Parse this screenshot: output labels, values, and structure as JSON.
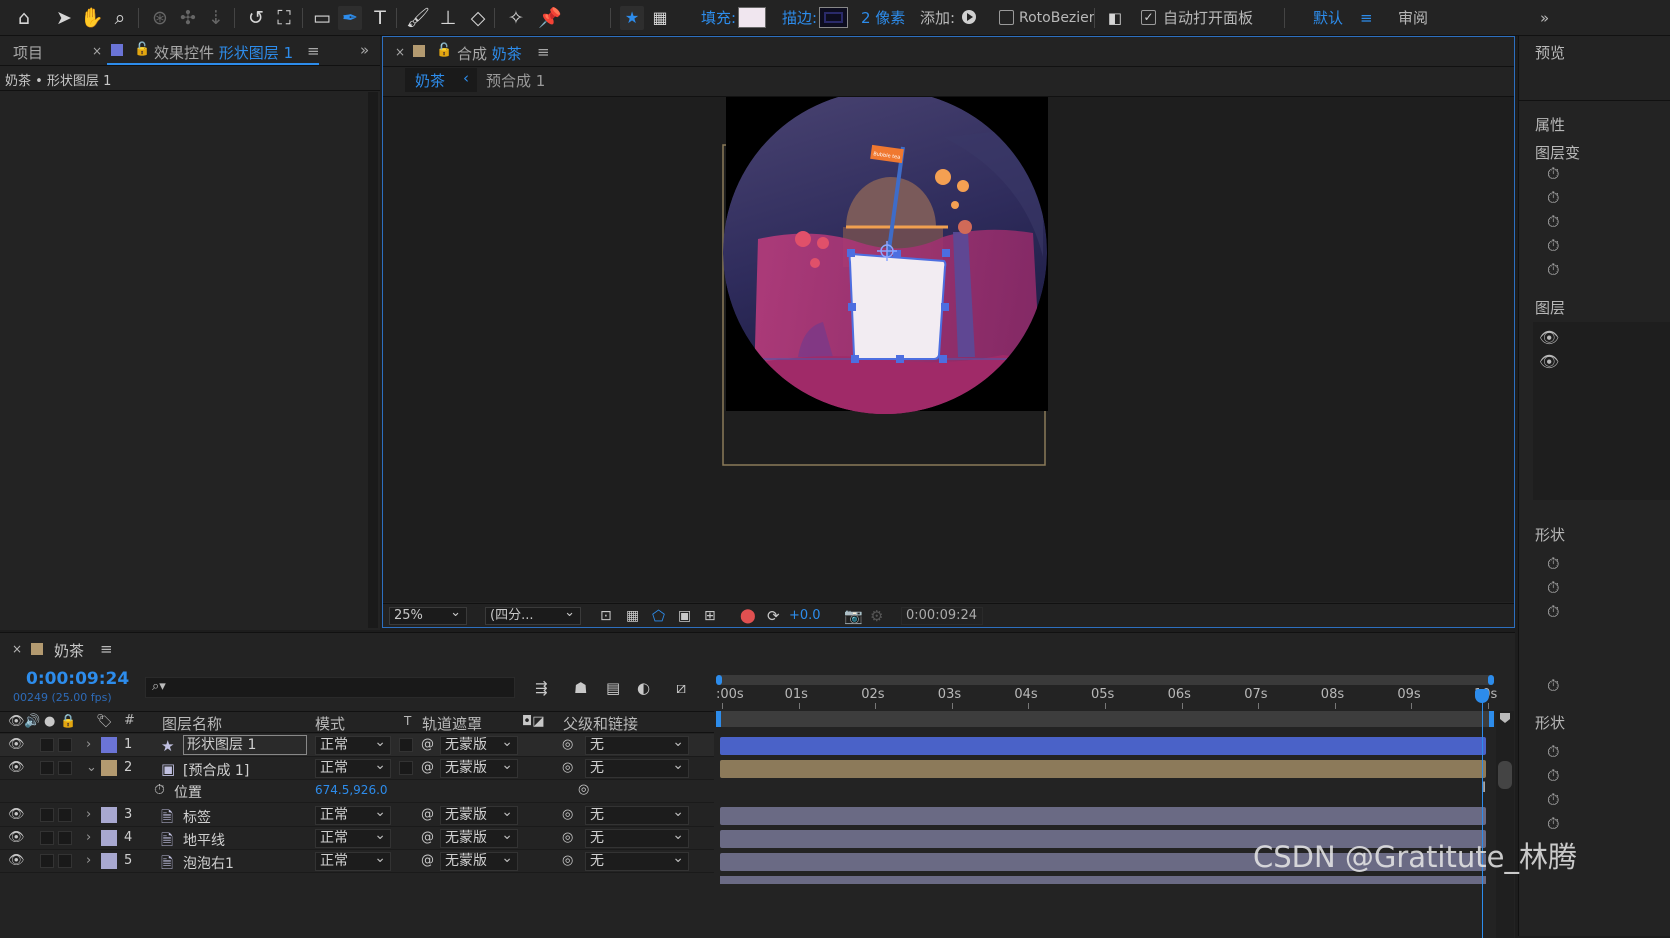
{
  "toolbar": {
    "fill_label": "填充:",
    "stroke_label": "描边:",
    "stroke_width": "2 像素",
    "add_label": "添加:",
    "rotobezier_label": "RotoBezier",
    "auto_open_label": "自动打开面板",
    "workspace_default": "默认",
    "workspace_review": "审阅",
    "fill_color": "#f0e6ef",
    "stroke_color": "#2a2a6a",
    "accent": "#2d8ceb"
  },
  "left_panel": {
    "tab_project": "项目",
    "tab_effects_prefix": "效果控件",
    "tab_effects_target": "形状图层 1",
    "breadcrumb": "奶茶 • 形状图层 1"
  },
  "comp_panel": {
    "tab_prefix": "合成",
    "tab_name": "奶茶",
    "crumb_current": "奶茶",
    "crumb_next": "预合成 1",
    "zoom": "25%",
    "resolution": "(四分...",
    "exposure": "+0.0",
    "timecode": "0:00:09:24",
    "flag_text": "Bubble tea"
  },
  "right_panel": {
    "preview": "预览",
    "properties": "属性",
    "layer_transform": "图层变",
    "layers": "图层",
    "shape_props": "形状",
    "shape_props2": "形状"
  },
  "timeline": {
    "comp_name": "奶茶",
    "timecode": "0:00:09:24",
    "frame_info": "00249 (25.00 fps)",
    "headers": {
      "number": "#",
      "layer_name": "图层名称",
      "mode": "模式",
      "t": "T",
      "track_matte": "轨道遮罩",
      "parent": "父级和链接"
    },
    "ruler": [
      ":00s",
      "01s",
      "02s",
      "03s",
      "04s",
      "05s",
      "06s",
      "07s",
      "08s",
      "09s",
      "10s"
    ],
    "layers": [
      {
        "num": "1",
        "name": "形状图层 1",
        "mode": "正常",
        "matte": "无蒙版",
        "parent": "无",
        "label_color": "#6b74d6",
        "bar_color": "#4a62c8"
      },
      {
        "num": "2",
        "name": "[预合成 1]",
        "mode": "正常",
        "matte": "无蒙版",
        "parent": "无",
        "label_color": "#b39a70",
        "bar_color": "#8c7a5a"
      },
      {
        "num": "3",
        "name": "标签",
        "mode": "正常",
        "matte": "无蒙版",
        "parent": "无",
        "label_color": "#a8a8d0",
        "bar_color": "#6a6a84"
      },
      {
        "num": "4",
        "name": "地平线",
        "mode": "正常",
        "matte": "无蒙版",
        "parent": "无",
        "label_color": "#a8a8d0",
        "bar_color": "#6a6a84"
      },
      {
        "num": "5",
        "name": "泡泡右1",
        "mode": "正常",
        "matte": "无蒙版",
        "parent": "无",
        "label_color": "#a8a8d0",
        "bar_color": "#6a6a84"
      }
    ],
    "position_property": {
      "name": "位置",
      "value": "674.5,926.0"
    }
  },
  "watermark": "CSDN @Gratitute_林腾"
}
